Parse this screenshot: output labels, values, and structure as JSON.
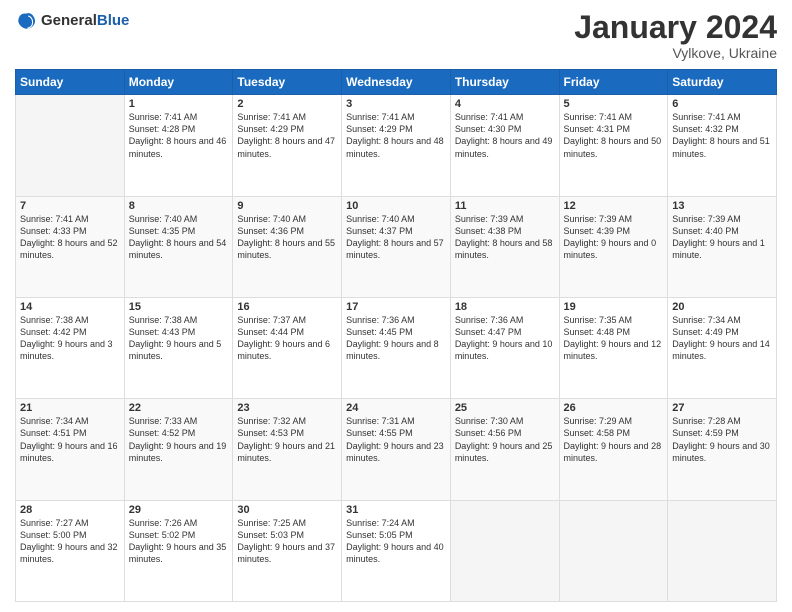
{
  "logo": {
    "general": "General",
    "blue": "Blue"
  },
  "title": "January 2024",
  "location": "Vylkove, Ukraine",
  "days_of_week": [
    "Sunday",
    "Monday",
    "Tuesday",
    "Wednesday",
    "Thursday",
    "Friday",
    "Saturday"
  ],
  "weeks": [
    [
      {
        "day": "",
        "sunrise": "",
        "sunset": "",
        "daylight": ""
      },
      {
        "day": "1",
        "sunrise": "Sunrise: 7:41 AM",
        "sunset": "Sunset: 4:28 PM",
        "daylight": "Daylight: 8 hours and 46 minutes."
      },
      {
        "day": "2",
        "sunrise": "Sunrise: 7:41 AM",
        "sunset": "Sunset: 4:29 PM",
        "daylight": "Daylight: 8 hours and 47 minutes."
      },
      {
        "day": "3",
        "sunrise": "Sunrise: 7:41 AM",
        "sunset": "Sunset: 4:29 PM",
        "daylight": "Daylight: 8 hours and 48 minutes."
      },
      {
        "day": "4",
        "sunrise": "Sunrise: 7:41 AM",
        "sunset": "Sunset: 4:30 PM",
        "daylight": "Daylight: 8 hours and 49 minutes."
      },
      {
        "day": "5",
        "sunrise": "Sunrise: 7:41 AM",
        "sunset": "Sunset: 4:31 PM",
        "daylight": "Daylight: 8 hours and 50 minutes."
      },
      {
        "day": "6",
        "sunrise": "Sunrise: 7:41 AM",
        "sunset": "Sunset: 4:32 PM",
        "daylight": "Daylight: 8 hours and 51 minutes."
      }
    ],
    [
      {
        "day": "7",
        "sunrise": "Sunrise: 7:41 AM",
        "sunset": "Sunset: 4:33 PM",
        "daylight": "Daylight: 8 hours and 52 minutes."
      },
      {
        "day": "8",
        "sunrise": "Sunrise: 7:40 AM",
        "sunset": "Sunset: 4:35 PM",
        "daylight": "Daylight: 8 hours and 54 minutes."
      },
      {
        "day": "9",
        "sunrise": "Sunrise: 7:40 AM",
        "sunset": "Sunset: 4:36 PM",
        "daylight": "Daylight: 8 hours and 55 minutes."
      },
      {
        "day": "10",
        "sunrise": "Sunrise: 7:40 AM",
        "sunset": "Sunset: 4:37 PM",
        "daylight": "Daylight: 8 hours and 57 minutes."
      },
      {
        "day": "11",
        "sunrise": "Sunrise: 7:39 AM",
        "sunset": "Sunset: 4:38 PM",
        "daylight": "Daylight: 8 hours and 58 minutes."
      },
      {
        "day": "12",
        "sunrise": "Sunrise: 7:39 AM",
        "sunset": "Sunset: 4:39 PM",
        "daylight": "Daylight: 9 hours and 0 minutes."
      },
      {
        "day": "13",
        "sunrise": "Sunrise: 7:39 AM",
        "sunset": "Sunset: 4:40 PM",
        "daylight": "Daylight: 9 hours and 1 minute."
      }
    ],
    [
      {
        "day": "14",
        "sunrise": "Sunrise: 7:38 AM",
        "sunset": "Sunset: 4:42 PM",
        "daylight": "Daylight: 9 hours and 3 minutes."
      },
      {
        "day": "15",
        "sunrise": "Sunrise: 7:38 AM",
        "sunset": "Sunset: 4:43 PM",
        "daylight": "Daylight: 9 hours and 5 minutes."
      },
      {
        "day": "16",
        "sunrise": "Sunrise: 7:37 AM",
        "sunset": "Sunset: 4:44 PM",
        "daylight": "Daylight: 9 hours and 6 minutes."
      },
      {
        "day": "17",
        "sunrise": "Sunrise: 7:36 AM",
        "sunset": "Sunset: 4:45 PM",
        "daylight": "Daylight: 9 hours and 8 minutes."
      },
      {
        "day": "18",
        "sunrise": "Sunrise: 7:36 AM",
        "sunset": "Sunset: 4:47 PM",
        "daylight": "Daylight: 9 hours and 10 minutes."
      },
      {
        "day": "19",
        "sunrise": "Sunrise: 7:35 AM",
        "sunset": "Sunset: 4:48 PM",
        "daylight": "Daylight: 9 hours and 12 minutes."
      },
      {
        "day": "20",
        "sunrise": "Sunrise: 7:34 AM",
        "sunset": "Sunset: 4:49 PM",
        "daylight": "Daylight: 9 hours and 14 minutes."
      }
    ],
    [
      {
        "day": "21",
        "sunrise": "Sunrise: 7:34 AM",
        "sunset": "Sunset: 4:51 PM",
        "daylight": "Daylight: 9 hours and 16 minutes."
      },
      {
        "day": "22",
        "sunrise": "Sunrise: 7:33 AM",
        "sunset": "Sunset: 4:52 PM",
        "daylight": "Daylight: 9 hours and 19 minutes."
      },
      {
        "day": "23",
        "sunrise": "Sunrise: 7:32 AM",
        "sunset": "Sunset: 4:53 PM",
        "daylight": "Daylight: 9 hours and 21 minutes."
      },
      {
        "day": "24",
        "sunrise": "Sunrise: 7:31 AM",
        "sunset": "Sunset: 4:55 PM",
        "daylight": "Daylight: 9 hours and 23 minutes."
      },
      {
        "day": "25",
        "sunrise": "Sunrise: 7:30 AM",
        "sunset": "Sunset: 4:56 PM",
        "daylight": "Daylight: 9 hours and 25 minutes."
      },
      {
        "day": "26",
        "sunrise": "Sunrise: 7:29 AM",
        "sunset": "Sunset: 4:58 PM",
        "daylight": "Daylight: 9 hours and 28 minutes."
      },
      {
        "day": "27",
        "sunrise": "Sunrise: 7:28 AM",
        "sunset": "Sunset: 4:59 PM",
        "daylight": "Daylight: 9 hours and 30 minutes."
      }
    ],
    [
      {
        "day": "28",
        "sunrise": "Sunrise: 7:27 AM",
        "sunset": "Sunset: 5:00 PM",
        "daylight": "Daylight: 9 hours and 32 minutes."
      },
      {
        "day": "29",
        "sunrise": "Sunrise: 7:26 AM",
        "sunset": "Sunset: 5:02 PM",
        "daylight": "Daylight: 9 hours and 35 minutes."
      },
      {
        "day": "30",
        "sunrise": "Sunrise: 7:25 AM",
        "sunset": "Sunset: 5:03 PM",
        "daylight": "Daylight: 9 hours and 37 minutes."
      },
      {
        "day": "31",
        "sunrise": "Sunrise: 7:24 AM",
        "sunset": "Sunset: 5:05 PM",
        "daylight": "Daylight: 9 hours and 40 minutes."
      },
      {
        "day": "",
        "sunrise": "",
        "sunset": "",
        "daylight": ""
      },
      {
        "day": "",
        "sunrise": "",
        "sunset": "",
        "daylight": ""
      },
      {
        "day": "",
        "sunrise": "",
        "sunset": "",
        "daylight": ""
      }
    ]
  ]
}
